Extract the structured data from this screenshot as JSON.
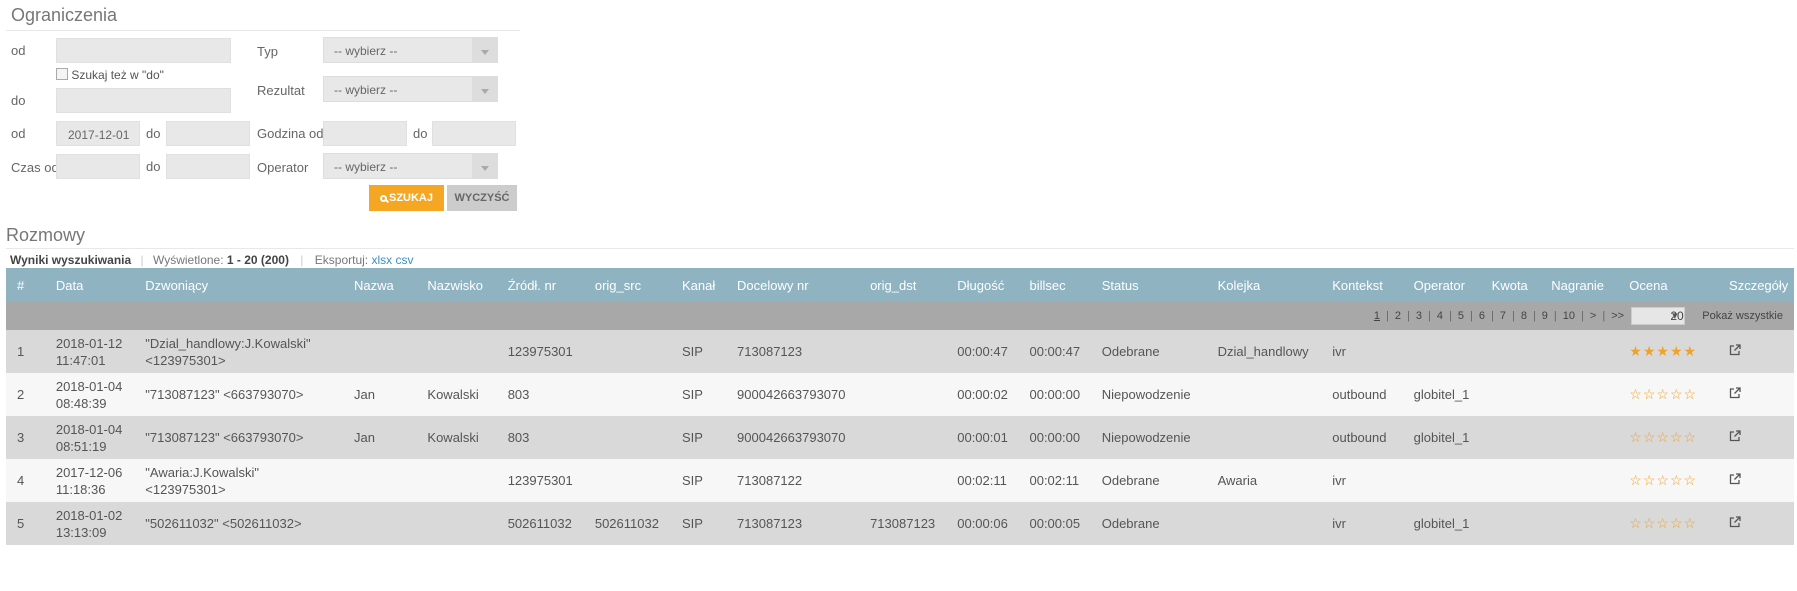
{
  "filters": {
    "title": "Ograniczenia",
    "from_label": "od",
    "also_search_label": "Szukaj też w \"do\"",
    "to_label": "do",
    "date_from_label": "od",
    "date_from_value": "2017-12-01",
    "date_to_label": "do",
    "duration_from_label": "Czas od",
    "duration_to_label": "do",
    "type_label": "Typ",
    "type_value": "-- wybierz --",
    "result_label": "Rezultat",
    "result_value": "-- wybierz --",
    "hour_from_label": "Godzina od",
    "hour_to_label": "do",
    "operator_label": "Operator",
    "operator_value": "-- wybierz --",
    "search_button": "SZUKAJ",
    "clear_button": "WYCZYŚĆ"
  },
  "results": {
    "title": "Rozmowy",
    "heading": "Wyniki wyszukiwania",
    "shown_label": "Wyświetlone:",
    "shown_value": "1 - 20 (200)",
    "export_label": "Eksportuj:",
    "export_xlsx": "xlsx",
    "export_csv": "csv"
  },
  "table": {
    "columns": [
      "#",
      "Data",
      "Dzwoniący",
      "Nazwa",
      "Nazwisko",
      "Źródł. nr",
      "orig_src",
      "Kanał",
      "Docelowy nr",
      "orig_dst",
      "Długość",
      "billsec",
      "Status",
      "Kolejka",
      "Kontekst",
      "Operator",
      "Kwota",
      "Nagranie",
      "Ocena",
      "Szczegóły"
    ],
    "pager": {
      "pages": [
        "1",
        "2",
        "3",
        "4",
        "5",
        "6",
        "7",
        "8",
        "9",
        "10",
        ">",
        ">>"
      ],
      "current": "1",
      "per_page": "20",
      "show_all": "Pokaż wszystkie"
    },
    "rows": [
      {
        "n": "1",
        "date": "2018-01-12",
        "time": "11:47:01",
        "caller1": "\"Dzial_handlowy:J.Kowalski\"",
        "caller2": "<123975301>",
        "name": "",
        "surname": "",
        "src": "123975301",
        "orig_src": "",
        "channel": "SIP",
        "dst": "713087123",
        "orig_dst": "",
        "duration": "00:00:47",
        "billsec": "00:00:47",
        "status": "Odebrane",
        "queue": "Dzial_handlowy",
        "context": "ivr",
        "operator": "",
        "amount": "",
        "recording": "",
        "rating": 5
      },
      {
        "n": "2",
        "date": "2018-01-04",
        "time": "08:48:39",
        "caller1": "\"713087123\" <663793070>",
        "caller2": "",
        "name": "Jan",
        "surname": "Kowalski",
        "src": "803",
        "orig_src": "",
        "channel": "SIP",
        "dst": "900042663793070",
        "orig_dst": "",
        "duration": "00:00:02",
        "billsec": "00:00:00",
        "status": "Niepowodzenie",
        "queue": "",
        "context": "outbound",
        "operator": "globitel_1",
        "amount": "",
        "recording": "",
        "rating": 0
      },
      {
        "n": "3",
        "date": "2018-01-04",
        "time": "08:51:19",
        "caller1": "\"713087123\" <663793070>",
        "caller2": "",
        "name": "Jan",
        "surname": "Kowalski",
        "src": "803",
        "orig_src": "",
        "channel": "SIP",
        "dst": "900042663793070",
        "orig_dst": "",
        "duration": "00:00:01",
        "billsec": "00:00:00",
        "status": "Niepowodzenie",
        "queue": "",
        "context": "outbound",
        "operator": "globitel_1",
        "amount": "",
        "recording": "",
        "rating": 0
      },
      {
        "n": "4",
        "date": "2017-12-06",
        "time": "11:18:36",
        "caller1": "\"Awaria:J.Kowalski\"",
        "caller2": "<123975301>",
        "name": "",
        "surname": "",
        "src": "123975301",
        "orig_src": "",
        "channel": "SIP",
        "dst": "713087122",
        "orig_dst": "",
        "duration": "00:02:11",
        "billsec": "00:02:11",
        "status": "Odebrane",
        "queue": "Awaria",
        "context": "ivr",
        "operator": "",
        "amount": "",
        "recording": "",
        "rating": 0
      },
      {
        "n": "5",
        "date": "2018-01-02",
        "time": "13:13:09",
        "caller1": "\"502611032\" <502611032>",
        "caller2": "",
        "name": "",
        "surname": "",
        "src": "502611032",
        "orig_src": "502611032",
        "channel": "SIP",
        "dst": "713087123",
        "orig_dst": "713087123",
        "duration": "00:00:06",
        "billsec": "00:00:05",
        "status": "Odebrane",
        "queue": "",
        "context": "ivr",
        "operator": "globitel_1",
        "amount": "",
        "recording": "",
        "rating": 0
      }
    ]
  },
  "colors": {
    "accent": "#f5a623",
    "header": "#8fb3c1",
    "link": "#3b8ec2"
  },
  "icons": {
    "search": "search-icon",
    "details": "external-link-icon",
    "star": "star-icon"
  }
}
